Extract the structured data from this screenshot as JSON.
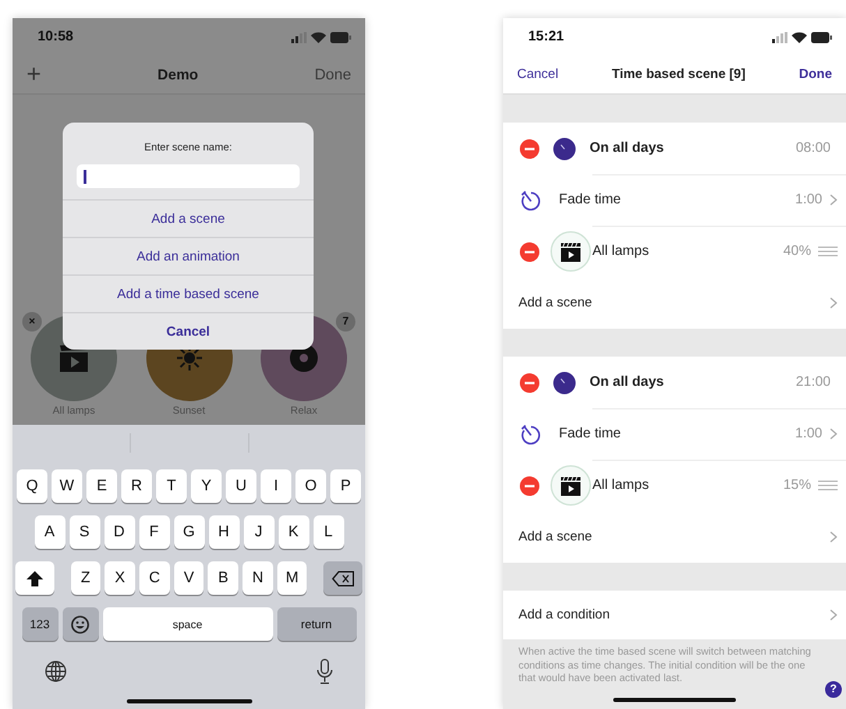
{
  "left_phone": {
    "status_bar": {
      "time": "10:58"
    },
    "nav": {
      "add": "+",
      "title": "Demo",
      "done": "Done"
    },
    "scenes": [
      {
        "label": "All lamps",
        "badge": "×"
      },
      {
        "label": "Sunset"
      },
      {
        "label": "Relax",
        "badge": "7"
      }
    ],
    "dialog": {
      "prompt": "Enter scene name:",
      "actions": [
        {
          "label": "Add a scene",
          "kind": "action"
        },
        {
          "label": "Add an animation",
          "kind": "action"
        },
        {
          "label": "Add a time based scene",
          "kind": "action"
        },
        {
          "label": "Cancel",
          "kind": "cancel"
        }
      ]
    },
    "keyboard": {
      "letter_rows": [
        [
          "Q",
          "W",
          "E",
          "R",
          "T",
          "Y",
          "U",
          "I",
          "O",
          "P"
        ],
        [
          "A",
          "S",
          "D",
          "F",
          "G",
          "H",
          "J",
          "K",
          "L"
        ],
        [
          "Z",
          "X",
          "C",
          "V",
          "B",
          "N",
          "M"
        ]
      ],
      "number_key": "123",
      "space_key": "space",
      "return_key": "return"
    }
  },
  "right_phone": {
    "status_bar": {
      "time": "15:21"
    },
    "nav": {
      "cancel": "Cancel",
      "title": "Time based scene [9]",
      "done": "Done"
    },
    "conditions": [
      {
        "days": "On all days",
        "time": "08:00",
        "fade_label": "Fade time",
        "fade": "1:00",
        "scenes": [
          {
            "name": "All lamps",
            "level_text": "40%"
          }
        ],
        "add_scene": "Add a scene"
      },
      {
        "days": "On all days",
        "time": "21:00",
        "fade_label": "Fade time",
        "fade": "1:00",
        "scenes": [
          {
            "name": "All lamps",
            "level_text": "15%"
          }
        ],
        "add_scene": "Add a scene"
      }
    ],
    "add_condition": "Add a condition",
    "footer": "When active the time based scene will switch between matching conditions as time changes. The initial condition will be the one that would have been activated last.",
    "help": "?"
  }
}
